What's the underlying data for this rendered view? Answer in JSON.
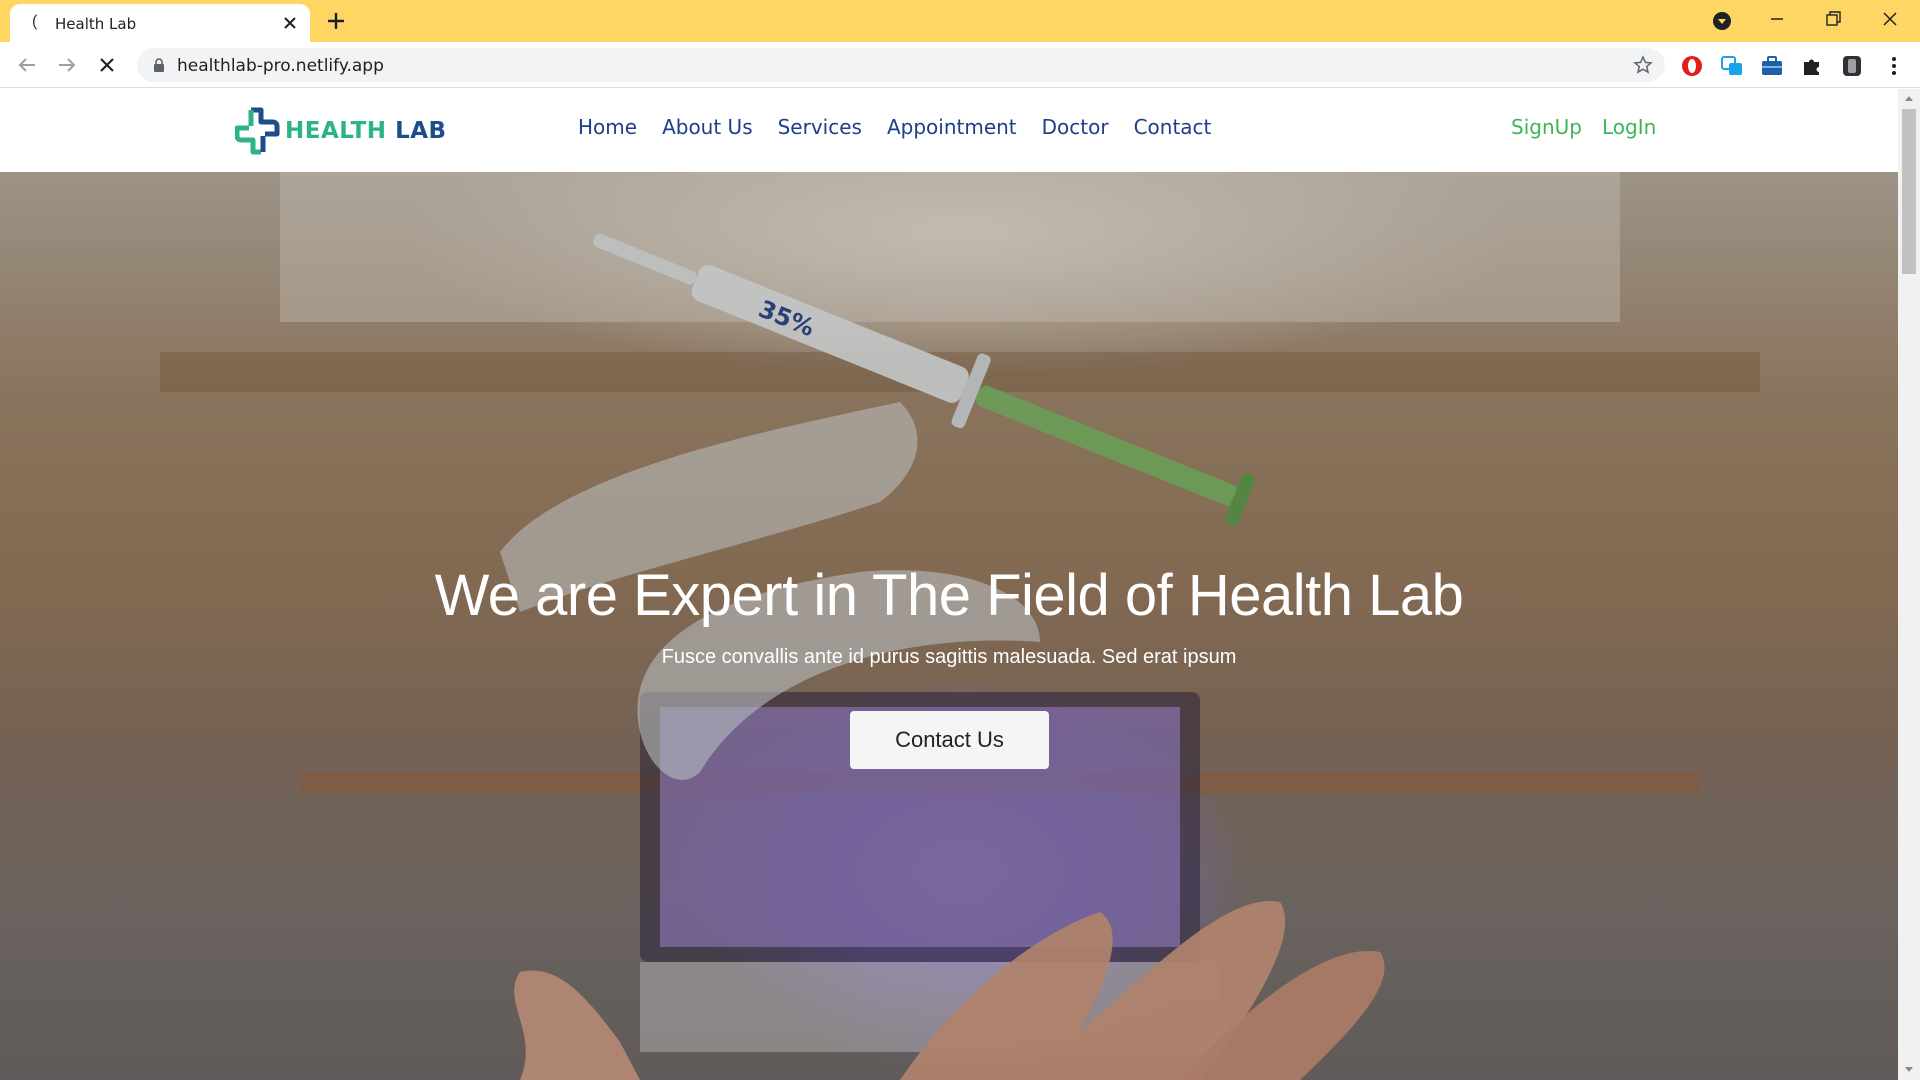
{
  "browser": {
    "tab_title": "Health Lab",
    "url": "healthlab-pro.netlify.app"
  },
  "site": {
    "logo_word1": "HEALTH",
    "logo_word2": "LAB",
    "nav": [
      {
        "label": "Home"
      },
      {
        "label": "About Us"
      },
      {
        "label": "Services"
      },
      {
        "label": "Appointment"
      },
      {
        "label": "Doctor"
      },
      {
        "label": "Contact"
      }
    ],
    "auth": {
      "signup": "SignUp",
      "login": "LogIn"
    }
  },
  "hero": {
    "title": "We are Expert in The Field of Health Lab",
    "subtitle": "Fusce convallis ante id purus sagittis malesuada. Sed erat ipsum",
    "button": "Contact Us",
    "syringe_label": "35%"
  },
  "colors": {
    "tabbar": "#fdd663",
    "nav_text": "#1d3f8a",
    "auth_text": "#3fb557",
    "logo_green": "#2db38a",
    "logo_blue": "#1d4e89"
  }
}
